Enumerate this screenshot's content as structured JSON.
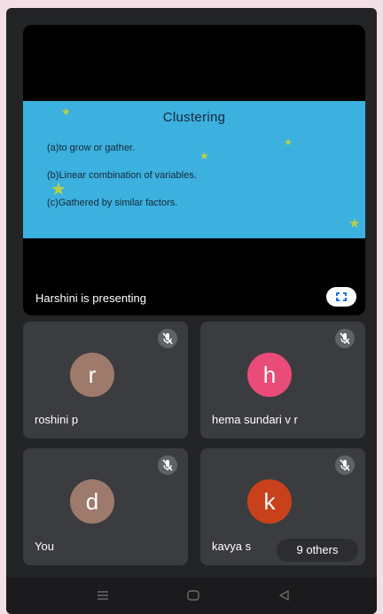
{
  "presentation": {
    "presenter_text": "Harshini is presenting",
    "slide": {
      "title": "Clustering",
      "lines": [
        "(a)to grow or gather.",
        "(b)Linear combination of variables.",
        "(c)Gathered by similar factors."
      ]
    }
  },
  "participants": [
    {
      "name": "roshini p",
      "initial": "r",
      "color": "#9e7a6c"
    },
    {
      "name": "hema sundari v r",
      "initial": "h",
      "color": "#ea4c7a"
    },
    {
      "name": "You",
      "initial": "d",
      "color": "#9e7a6c"
    },
    {
      "name": "kavya s",
      "initial": "k",
      "color": "#c8411a"
    }
  ],
  "others_badge": "9 others",
  "colors": {
    "background": "#f2dfe6",
    "slide_background": "#3cb0de",
    "tile_background": "#3b3c3f"
  },
  "icons": [
    "fullscreen-icon",
    "mic-off-icon",
    "menu-icon",
    "home-icon",
    "back-icon"
  ]
}
